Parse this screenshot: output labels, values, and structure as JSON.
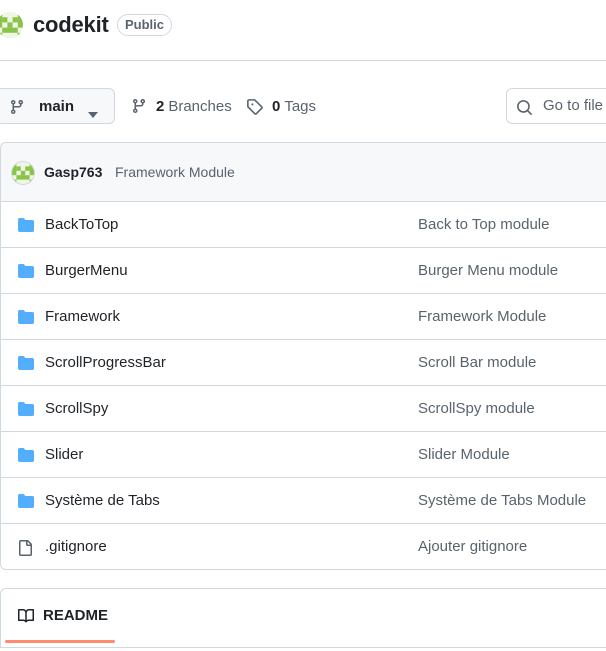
{
  "repo": {
    "name": "codekit",
    "visibility": "Public"
  },
  "toolbar": {
    "branch": "main",
    "branches_count": "2",
    "branches_label": "Branches",
    "tags_count": "0",
    "tags_label": "Tags",
    "search_placeholder": "Go to file"
  },
  "latest_commit": {
    "author": "Gasp763",
    "message": "Framework Module"
  },
  "files": [
    {
      "name": "BackToTop",
      "type": "folder",
      "commit": "Back to Top module"
    },
    {
      "name": "BurgerMenu",
      "type": "folder",
      "commit": "Burger Menu module"
    },
    {
      "name": "Framework",
      "type": "folder",
      "commit": "Framework Module"
    },
    {
      "name": "ScrollProgressBar",
      "type": "folder",
      "commit": "Scroll Bar module"
    },
    {
      "name": "ScrollSpy",
      "type": "folder",
      "commit": "ScrollSpy module"
    },
    {
      "name": "Slider",
      "type": "folder",
      "commit": "Slider Module"
    },
    {
      "name": "Système de Tabs",
      "type": "folder",
      "commit": "Système de Tabs Module"
    },
    {
      "name": ".gitignore",
      "type": "file",
      "commit": "Ajouter gitignore"
    }
  ],
  "readme": {
    "tab_label": "README"
  },
  "colors": {
    "folder": "#54aeff",
    "accent_underline": "#fd8c73",
    "avatar": "#8bc34a"
  },
  "icons": {
    "branch": "git-branch-icon",
    "tag": "tag-icon",
    "search": "search-icon",
    "folder": "folder-icon",
    "file": "file-icon",
    "book": "book-icon",
    "caret": "triangle-down-icon"
  }
}
